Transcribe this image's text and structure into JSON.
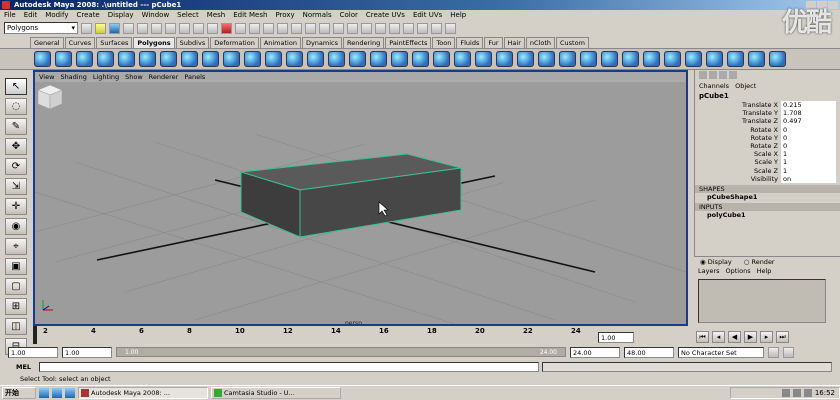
{
  "window": {
    "title": "Autodesk Maya 2008: .\\untitled   ---   pCube1",
    "watermark": "优酷"
  },
  "menus": [
    "File",
    "Edit",
    "Modify",
    "Create",
    "Display",
    "Window",
    "Select",
    "Mesh",
    "Edit Mesh",
    "Proxy",
    "Normals",
    "Color",
    "Create UVs",
    "Edit UVs",
    "Help"
  ],
  "status_line": {
    "menu_set": "Polygons"
  },
  "shelf_tabs": [
    "General",
    "Curves",
    "Surfaces",
    "Polygons",
    "Subdivs",
    "Deformation",
    "Animation",
    "Dynamics",
    "Rendering",
    "PaintEffects",
    "Toon",
    "Fluids",
    "Fur",
    "Hair",
    "nCloth",
    "Custom"
  ],
  "active_shelf_tab": "Polygons",
  "panel_menu": [
    "View",
    "Shading",
    "Lighting",
    "Show",
    "Renderer",
    "Panels"
  ],
  "viewport": {
    "camera": "persp"
  },
  "channel_box": {
    "menu": [
      "Channels",
      "Object"
    ],
    "object": "pCube1",
    "attributes": [
      {
        "name": "Translate X",
        "value": "0.215"
      },
      {
        "name": "Translate Y",
        "value": "1.708"
      },
      {
        "name": "Translate Z",
        "value": "0.497"
      },
      {
        "name": "Rotate X",
        "value": "0"
      },
      {
        "name": "Rotate Y",
        "value": "0"
      },
      {
        "name": "Rotate Z",
        "value": "0"
      },
      {
        "name": "Scale X",
        "value": "1"
      },
      {
        "name": "Scale Y",
        "value": "1"
      },
      {
        "name": "Scale Z",
        "value": "1"
      },
      {
        "name": "Visibility",
        "value": "on"
      }
    ],
    "shapes_title": "SHAPES",
    "shape": "pCubeShape1",
    "inputs_title": "INPUTS",
    "input": "polyCube1"
  },
  "layer_editor": {
    "display_label": "Display",
    "render_label": "Render",
    "menu": [
      "Layers",
      "Options",
      "Help"
    ]
  },
  "time_slider": {
    "ticks": [
      "2",
      "4",
      "6",
      "8",
      "10",
      "12",
      "14",
      "16",
      "18",
      "20",
      "22",
      "24"
    ],
    "current_frame": "1.00"
  },
  "range_slider": {
    "start_time": "1.00",
    "playback_start": "1.00",
    "bar_start": "1.00",
    "bar_end": "24.00",
    "playback_end": "24.00",
    "end_time": "48.00",
    "character_set": "No Character Set"
  },
  "command_line": {
    "label": "MEL"
  },
  "help_line": "Select Tool: select an object",
  "taskbar": {
    "start_label": "开始",
    "tasks": [
      "Autodesk Maya 2008: ...",
      "Camtasia Studio - U..."
    ],
    "clock": "16:52"
  }
}
